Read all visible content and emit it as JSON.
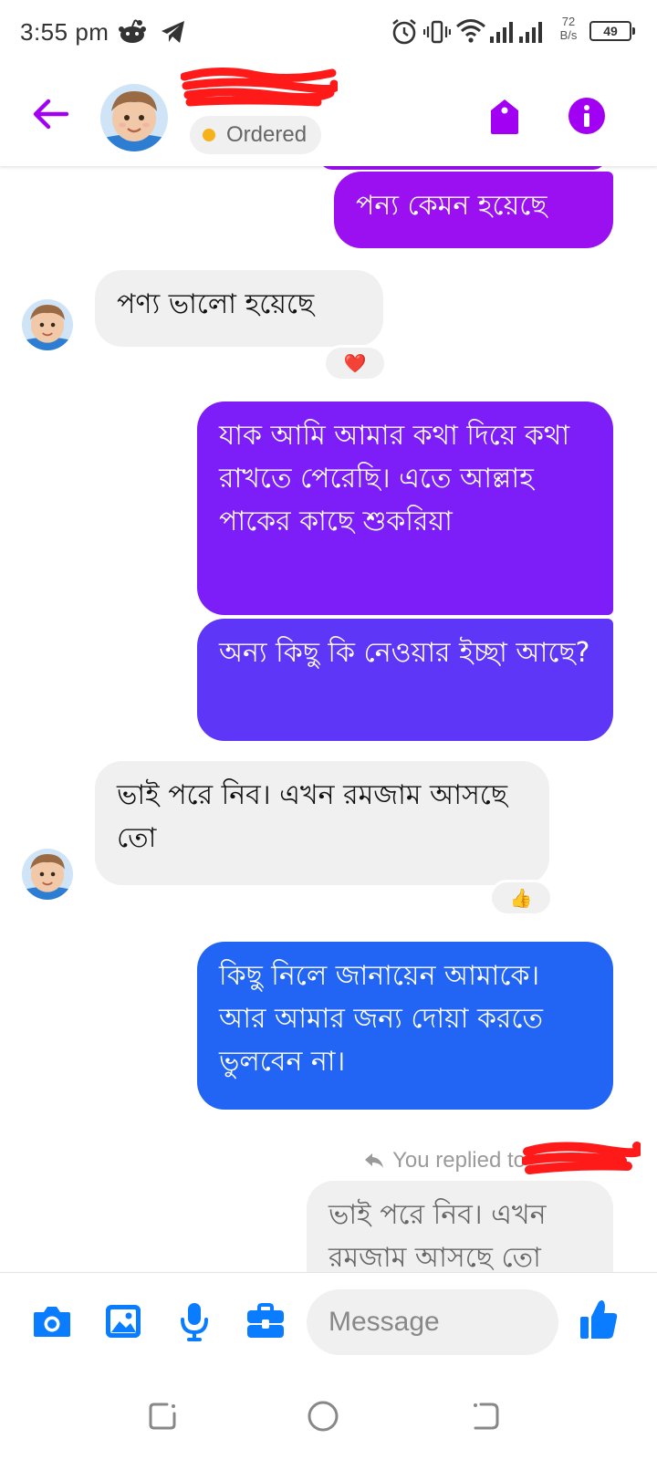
{
  "status_bar": {
    "time": "3:55 pm",
    "net_speed_value": "72",
    "net_speed_unit": "B/s",
    "battery": "49"
  },
  "header": {
    "contact_status": "Ordered",
    "status_color": "#f5b21b",
    "accent_color": "#a100f2"
  },
  "messages": [
    {
      "direction": "out",
      "text": "পন্য কেমন হয়েছে"
    },
    {
      "direction": "in",
      "text": "পণ্য ভালো  হয়েছে",
      "reaction": "❤️"
    },
    {
      "direction": "out",
      "text": "যাক আমি আমার কথা দিয়ে কথা রাখতে পেরেছি। এতে আল্লাহ পাকের কাছে শুকরিয়া"
    },
    {
      "direction": "out",
      "text": "অন্য কিছু কি নেওয়ার ইচ্ছা আছে?"
    },
    {
      "direction": "in",
      "text": "ভাই পরে নিব। এখন রমজাম আসছে তো",
      "reaction": "👍"
    },
    {
      "direction": "out",
      "text": "কিছু নিলে জানায়েন আমাকে। আর আমার জন্য দোয়া করতে ভুলবেন না।"
    }
  ],
  "reply": {
    "label": "You replied to",
    "quoted_text": "ভাই পরে নিব। এখন রমজাম আসছে তো"
  },
  "composer": {
    "placeholder": "Message",
    "icon_color": "#0a7cff"
  }
}
